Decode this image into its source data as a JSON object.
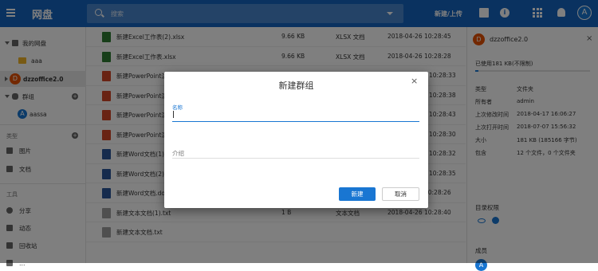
{
  "header": {
    "app_title": "网盘",
    "search_placeholder": "搜索",
    "new_upload": "新建/上传",
    "avatar_letter": "A"
  },
  "sidebar": {
    "my_drive": "我的网盘",
    "folder_aaa": "aaa",
    "org": {
      "letter": "D",
      "label": "dzzoffice2.0"
    },
    "groups": "群组",
    "group_member": {
      "letter": "A",
      "label": "aassa"
    },
    "types_title": "类型",
    "images": "图片",
    "documents": "文档",
    "tools_title": "工具",
    "share": "分享",
    "activity": "动态",
    "recycle": "回收站",
    "more": "…"
  },
  "files": [
    {
      "name": "新建Excel工作表(2).xlsx",
      "size": "9.66 KB",
      "type": "XLSX 文档",
      "date": "2018-04-26 10:28:45",
      "kind": "xlsx"
    },
    {
      "name": "新建Excel工作表.xlsx",
      "size": "9.66 KB",
      "type": "XLSX 文档",
      "date": "2018-04-26 10:28:28",
      "kind": "xlsx"
    },
    {
      "name": "新建PowerPoint演",
      "size": "",
      "type": "",
      "date": "10:28:33",
      "kind": "pptx"
    },
    {
      "name": "新建PowerPoint演",
      "size": "",
      "type": "",
      "date": "10:28:38",
      "kind": "pptx"
    },
    {
      "name": "新建PowerPoint演",
      "size": "",
      "type": "",
      "date": "10:28:43",
      "kind": "pptx"
    },
    {
      "name": "新建PowerPoint演",
      "size": "",
      "type": "",
      "date": "10:28:30",
      "kind": "pptx"
    },
    {
      "name": "新建Word文档(1).",
      "size": "",
      "type": "",
      "date": "10:28:32",
      "kind": "docx"
    },
    {
      "name": "新建Word文档(2).",
      "size": "",
      "type": "",
      "date": "10:28:35",
      "kind": "docx"
    },
    {
      "name": "新建Word文档.docx",
      "size": "11.3 KB",
      "type": "DOCX 文档",
      "date": "2018-04-26 10:28:26",
      "kind": "docx"
    },
    {
      "name": "新建文本文档(1).txt",
      "size": "1 B",
      "type": "文本文档",
      "date": "2018-04-26 10:28:40",
      "kind": "txt"
    },
    {
      "name": "新建文本文档.txt",
      "size": "",
      "type": "",
      "date": "",
      "kind": "txt"
    }
  ],
  "detail": {
    "avatar_letter": "D",
    "title": "dzzoffice2.0",
    "used": "已使用181 KB(不限制)",
    "usage_fraction": 0.03,
    "rows": [
      {
        "key": "类型",
        "value": "文件夹"
      },
      {
        "key": "所有者",
        "value": "admin"
      },
      {
        "key": "上次修改时间",
        "value": "2018-04-17 16:06:27"
      },
      {
        "key": "上次打开时间",
        "value": "2018-07-07 15:56:32"
      },
      {
        "key": "大小",
        "value": "181 KB (185166 字节)"
      },
      {
        "key": "包含",
        "value": "12 个文件，0 个文件夹"
      }
    ],
    "permissions_title": "目录权限",
    "members_title": "成员",
    "member_letter": "A"
  },
  "dialog": {
    "title": "新建群组",
    "name_label": "名称",
    "name_value": "",
    "desc_label": "介绍",
    "create_label": "新建",
    "cancel_label": "取消",
    "close_symbol": "×"
  }
}
